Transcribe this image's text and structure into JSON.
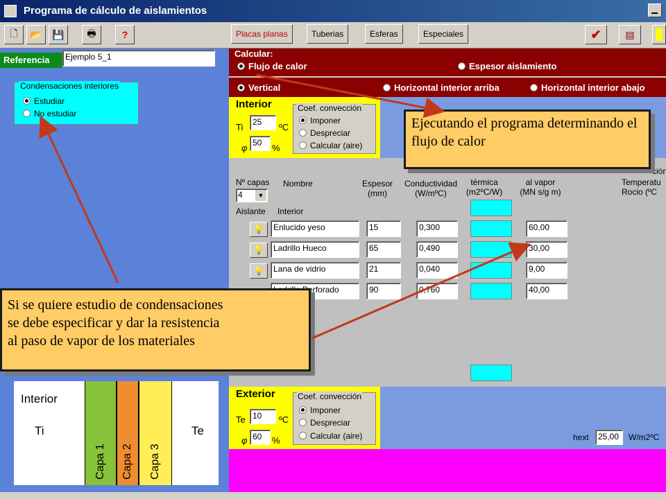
{
  "window": {
    "title": "Programa de cálculo de aislamientos"
  },
  "toolbar": {
    "tabs": [
      "Placas planas",
      "Tuberias",
      "Esferas",
      "Especiales"
    ]
  },
  "referencia": {
    "label": "Referencia",
    "value": "Ejemplo 5_1"
  },
  "condensaciones": {
    "legend": "Condensaciones interiores",
    "options": [
      "Estudiar",
      "No estudiar"
    ],
    "selected": "Estudiar"
  },
  "calcular": {
    "legend": "Calcular:",
    "options": [
      "Flujo de calor",
      "Espesor aislamiento"
    ],
    "selected": "Flujo de calor"
  },
  "orientation": {
    "options": [
      "Vertical",
      "Horizontal interior arriba",
      "Horizontal interior abajo"
    ],
    "selected": "Vertical"
  },
  "interior": {
    "title": "Interior",
    "ti_label": "Ti",
    "ti_value": "25",
    "ti_unit": "ºC",
    "phi_label": "φ",
    "phi_value": "50",
    "phi_unit": "%",
    "conv_legend": "Coef. convección",
    "conv_options": [
      "Imponer",
      "Despreciar",
      "Calcular (aire)"
    ],
    "conv_selected": "Imponer"
  },
  "exterior": {
    "title": "Exterior",
    "te_label": "Te",
    "te_value": "10",
    "te_unit": "ºC",
    "phi_label": "φ",
    "phi_value": "60",
    "phi_unit": "%",
    "conv_legend": "Coef. convección",
    "conv_options": [
      "Imponer",
      "Despreciar",
      "Calcular (aire)"
    ],
    "conv_selected": "Imponer",
    "hext_label": "hext",
    "hext_value": "25,00",
    "hext_unit": "W/m2ºC"
  },
  "table": {
    "ncapas_label": "Nº capas",
    "ncapas_value": "4",
    "headers": {
      "nombre": "Nombre",
      "espesor": "Espesor\n(mm)",
      "conductividad": "Conductividad\n(W/mºC)",
      "termica": "térmica\n(m2ºC/W)",
      "vapor": "al vapor\n(MN s/g m)",
      "rocio_top": "ción",
      "rocio": "Temperatu\nRocio (ºC"
    },
    "aislante_label": "Aislante",
    "interior_label": "Interior",
    "rows": [
      {
        "nombre": "Enlucido yeso",
        "espesor": "15",
        "conductividad": "0,300",
        "vapor": "60,00"
      },
      {
        "nombre": "Ladrillo Hueco",
        "espesor": "65",
        "conductividad": "0,490",
        "vapor": "30,00"
      },
      {
        "nombre": "Lana de vidrio",
        "espesor": "21",
        "conductividad": "0,040",
        "vapor": "9,00"
      },
      {
        "nombre": "Ladrillo Perforado",
        "espesor": "90",
        "conductividad": "0,760",
        "vapor": "40,00"
      }
    ]
  },
  "diagram": {
    "interior_label": "Interior",
    "ti": "Ti",
    "te": "Te",
    "capas": [
      "Capa 1",
      "Capa 2",
      "Capa 3"
    ],
    "colors": [
      "#88c23a",
      "#f08c30",
      "#ffee55"
    ]
  },
  "callouts": {
    "top": "Ejecutando el programa determinando el flujo de calor",
    "bottom_lines": [
      "Si se quiere estudio de condensaciones",
      "se debe especificar y dar la resistencia",
      "al paso de vapor de los materiales"
    ]
  },
  "colors": {
    "panel_blue": "#5b82d8",
    "dark_red": "#8b0000",
    "magenta": "#ff00ff",
    "cyan": "#00ffff",
    "yellow": "#ffff00",
    "callout": "#ffcc66"
  }
}
